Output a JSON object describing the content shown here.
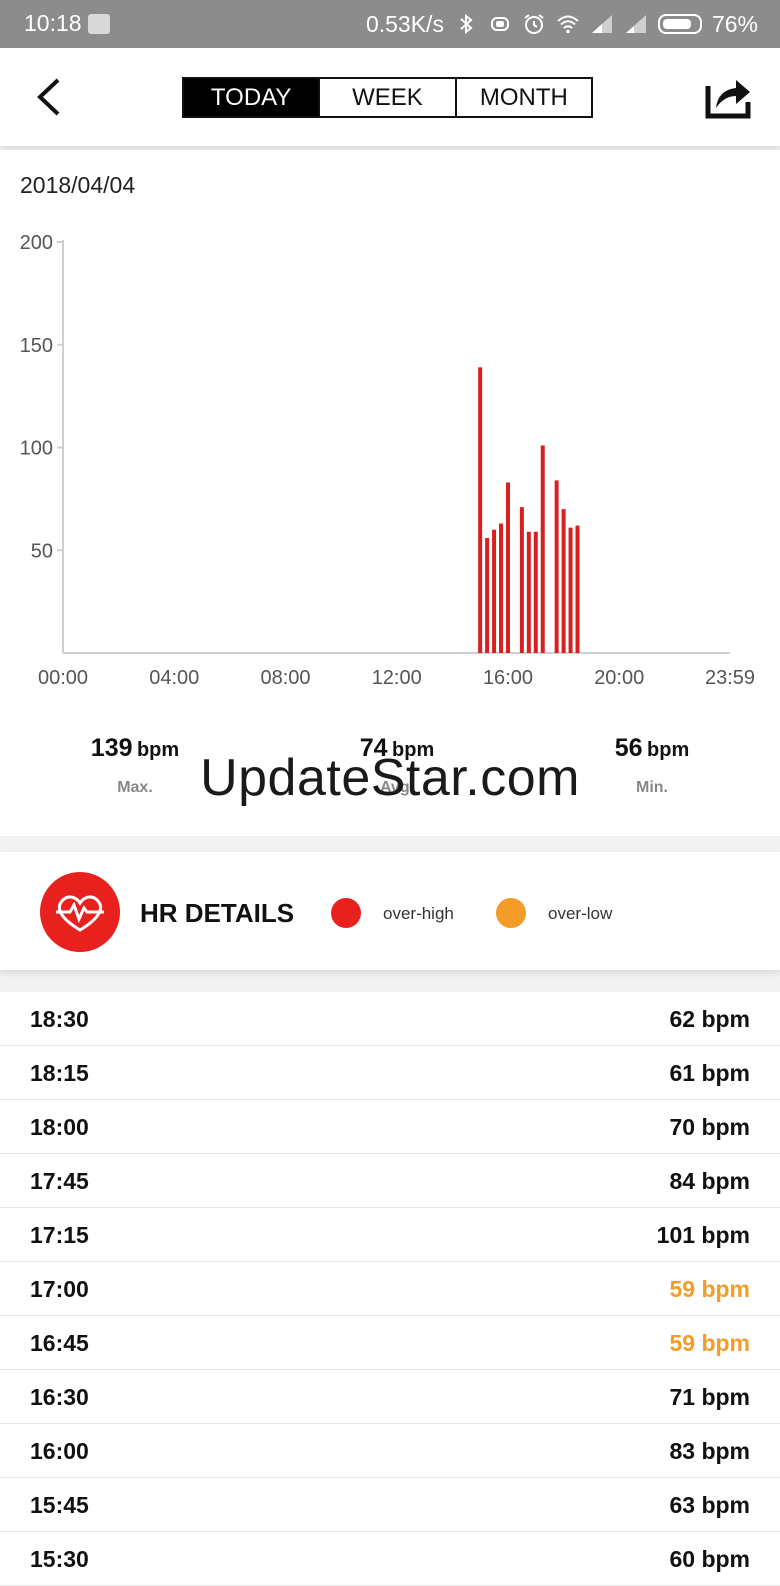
{
  "status_bar": {
    "time": "10:18",
    "speed": "0.53K/s",
    "battery": "76%"
  },
  "nav": {
    "tabs": [
      {
        "label": "TODAY",
        "active": true
      },
      {
        "label": "WEEK",
        "active": false
      },
      {
        "label": "MONTH",
        "active": false
      }
    ],
    "back_icon": "chevron-left-icon",
    "share_icon": "share-icon"
  },
  "date": "2018/04/04",
  "chart_data": {
    "type": "bar",
    "title": "",
    "xlabel": "",
    "ylabel": "",
    "ylim": [
      0,
      200
    ],
    "yticks": [
      50,
      100,
      150,
      200
    ],
    "xticks": [
      "00:00",
      "04:00",
      "08:00",
      "12:00",
      "16:00",
      "20:00",
      "23:59"
    ],
    "xlim_minutes": [
      0,
      1439
    ],
    "grid": false,
    "color": "#d7201f",
    "x": [
      "15:00",
      "15:15",
      "15:30",
      "15:45",
      "16:00",
      "16:30",
      "16:45",
      "17:00",
      "17:15",
      "17:45",
      "18:00",
      "18:15",
      "18:30"
    ],
    "values": [
      139,
      56,
      60,
      63,
      83,
      71,
      59,
      59,
      101,
      84,
      70,
      61,
      62
    ]
  },
  "stats": {
    "max": {
      "value": "139",
      "unit": "bpm",
      "label": "Max."
    },
    "avg": {
      "value": "74",
      "unit": "bpm",
      "label": "Avg."
    },
    "min": {
      "value": "56",
      "unit": "bpm",
      "label": "Min."
    }
  },
  "watermark": "UpdateStar.com",
  "hr": {
    "title": "HR DETAILS",
    "icon": "heart-pulse-icon",
    "legend": [
      {
        "label": "over-high",
        "color": "#e8211f"
      },
      {
        "label": "over-low",
        "color": "#f39c28"
      }
    ]
  },
  "list": [
    {
      "time": "18:30",
      "value": "62 bpm",
      "low": false
    },
    {
      "time": "18:15",
      "value": "61 bpm",
      "low": false
    },
    {
      "time": "18:00",
      "value": "70 bpm",
      "low": false
    },
    {
      "time": "17:45",
      "value": "84 bpm",
      "low": false
    },
    {
      "time": "17:15",
      "value": "101 bpm",
      "low": false
    },
    {
      "time": "17:00",
      "value": "59 bpm",
      "low": true
    },
    {
      "time": "16:45",
      "value": "59 bpm",
      "low": true
    },
    {
      "time": "16:30",
      "value": "71 bpm",
      "low": false
    },
    {
      "time": "16:00",
      "value": "83 bpm",
      "low": false
    },
    {
      "time": "15:45",
      "value": "63 bpm",
      "low": false
    },
    {
      "time": "15:30",
      "value": "60 bpm",
      "low": false
    }
  ]
}
